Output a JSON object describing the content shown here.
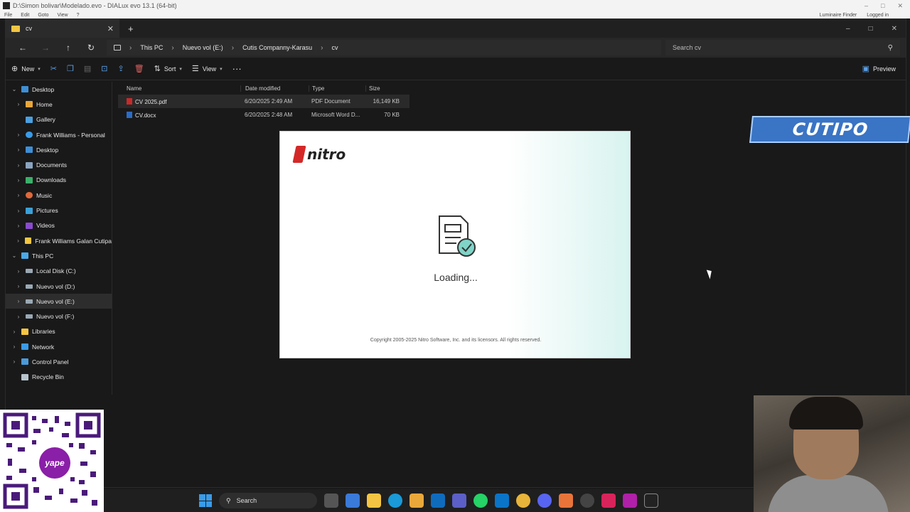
{
  "background_app": {
    "title": "D:\\Simon bolivar\\Modelado.evo - DIALux evo 13.1  (64-bit)",
    "menu": [
      "File",
      "Edit",
      "Goto",
      "View",
      "?"
    ],
    "menu_right": [
      "Luminaire Finder",
      "Logged in"
    ]
  },
  "explorer": {
    "tab": {
      "label": "cv"
    },
    "breadcrumb": [
      "This PC",
      "Nuevo vol (E:)",
      "Cutis Companny-Karasu",
      "cv"
    ],
    "search": {
      "placeholder": "Search cv"
    },
    "commands": {
      "new": "New",
      "sort": "Sort",
      "view": "View",
      "preview": "Preview"
    },
    "sidebar": [
      {
        "label": "Desktop",
        "icon": "desktop-icon",
        "chevron": "down",
        "indent": 0
      },
      {
        "label": "Home",
        "icon": "home-icon",
        "chevron": "right",
        "indent": 1
      },
      {
        "label": "Gallery",
        "icon": "gallery-icon",
        "chevron": "",
        "indent": 1
      },
      {
        "label": "Frank Williams - Personal",
        "icon": "cloud-icon",
        "chevron": "right",
        "indent": 1
      },
      {
        "label": "Desktop",
        "icon": "desktop-icon",
        "chevron": "right",
        "indent": 1
      },
      {
        "label": "Documents",
        "icon": "documents-icon",
        "chevron": "right",
        "indent": 1
      },
      {
        "label": "Downloads",
        "icon": "download-icon",
        "chevron": "right",
        "indent": 1
      },
      {
        "label": "Music",
        "icon": "music-icon",
        "chevron": "right",
        "indent": 1
      },
      {
        "label": "Pictures",
        "icon": "pictures-icon",
        "chevron": "right",
        "indent": 1
      },
      {
        "label": "Videos",
        "icon": "videos-icon",
        "chevron": "right",
        "indent": 1
      },
      {
        "label": "Frank Williams Galan Cutipa",
        "icon": "folder-icon",
        "chevron": "right",
        "indent": 1
      },
      {
        "label": "This PC",
        "icon": "pc-icon",
        "chevron": "down",
        "indent": 1
      },
      {
        "label": "Local Disk (C:)",
        "icon": "drive-icon",
        "chevron": "right",
        "indent": 2
      },
      {
        "label": "Nuevo vol (D:)",
        "icon": "drive-icon",
        "chevron": "right",
        "indent": 2
      },
      {
        "label": "Nuevo vol (E:)",
        "icon": "drive-icon",
        "chevron": "right",
        "indent": 2
      },
      {
        "label": "Nuevo vol (F:)",
        "icon": "drive-icon",
        "chevron": "right",
        "indent": 2
      },
      {
        "label": "Libraries",
        "icon": "libraries-icon",
        "chevron": "right",
        "indent": 1
      },
      {
        "label": "Network",
        "icon": "network-icon",
        "chevron": "right",
        "indent": 1
      },
      {
        "label": "Control Panel",
        "icon": "control-panel-icon",
        "chevron": "right",
        "indent": 1
      },
      {
        "label": "Recycle Bin",
        "icon": "recycle-bin-icon",
        "chevron": "",
        "indent": 1
      }
    ],
    "selected_sidebar": "Nuevo vol (E:)",
    "columns": [
      "Name",
      "Date modified",
      "Type",
      "Size"
    ],
    "files": [
      {
        "name": "CV 2025.pdf",
        "date": "6/20/2025 2:49 AM",
        "type": "PDF Document",
        "size": "16,149 KB",
        "kind": "pdf"
      },
      {
        "name": "CV.docx",
        "date": "6/20/2025 2:48 AM",
        "type": "Microsoft Word D...",
        "size": "70 KB",
        "kind": "doc"
      }
    ]
  },
  "splash": {
    "brand": "nitro",
    "status": "Loading...",
    "copyright": "Copyright 2005-2025 Nitro Software, Inc. and its licensors. All rights reserved."
  },
  "overlay": {
    "banner": "CUTIPO",
    "qr_label": "yape"
  },
  "taskbar": {
    "search": "Search"
  },
  "colors": {
    "accent": "#3a9be8",
    "nitro_red": "#d42828",
    "banner_blue": "#3a74c4"
  }
}
